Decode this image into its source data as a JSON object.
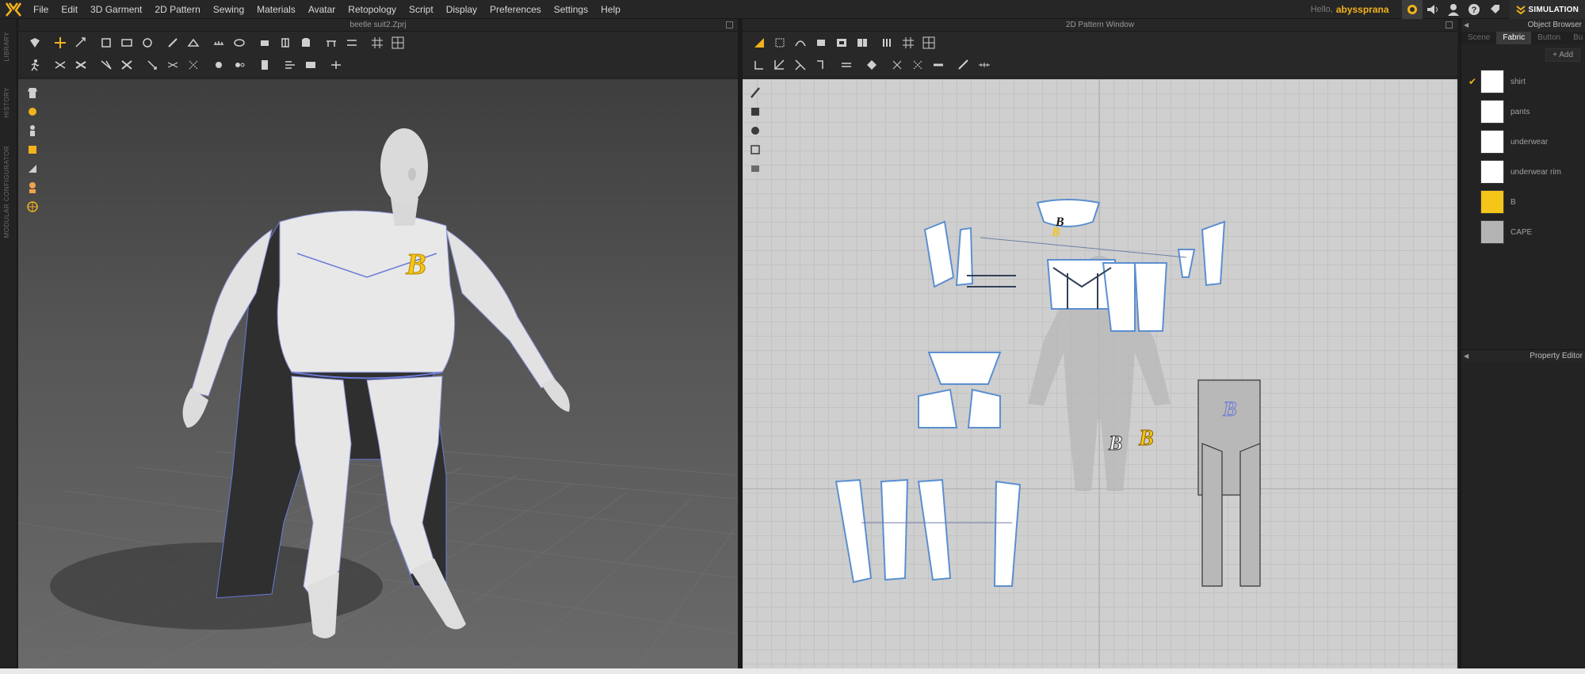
{
  "app": {
    "logo_text": "M"
  },
  "menu": {
    "items": [
      "File",
      "Edit",
      "3D Garment",
      "2D Pattern",
      "Sewing",
      "Materials",
      "Avatar",
      "Retopology",
      "Script",
      "Display",
      "Preferences",
      "Settings",
      "Help"
    ]
  },
  "user": {
    "hello": "Hello,",
    "name": "abyssprana"
  },
  "mode": {
    "label": "SIMULATION"
  },
  "left_strip": {
    "tabs": [
      "LIBRARY",
      "HISTORY",
      "MODULAR CONFIGURATOR"
    ]
  },
  "window3d": {
    "title": "beetle suit2.Zprj"
  },
  "window2d": {
    "title": "2D Pattern Window"
  },
  "object_browser": {
    "title": "Object Browser",
    "tabs": [
      "Scene",
      "Fabric",
      "Button",
      "Bu"
    ],
    "active_tab": "Fabric",
    "add_label": "+ Add",
    "fabrics": [
      {
        "name": "shirt",
        "color": "#ffffff",
        "checked": true
      },
      {
        "name": "pants",
        "color": "#ffffff",
        "checked": false
      },
      {
        "name": "underwear",
        "color": "#ffffff",
        "checked": false
      },
      {
        "name": "underwear rim",
        "color": "#ffffff",
        "checked": false
      },
      {
        "name": "B",
        "color": "#f5c518",
        "checked": false
      },
      {
        "name": "CAPE",
        "color": "#b4b4b4",
        "checked": false
      }
    ]
  },
  "property_editor": {
    "title": "Property Editor"
  },
  "logo_letter": "B",
  "colors": {
    "accent": "#f2b21c",
    "outline": "#6a7ad8",
    "piece_outline": "#5b8fd0"
  }
}
